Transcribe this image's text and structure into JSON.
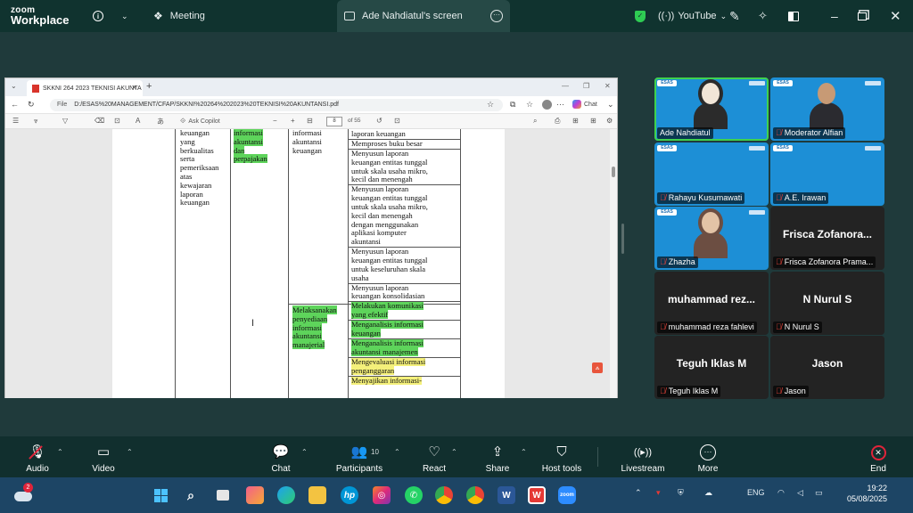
{
  "topbar": {
    "logo_line1": "zoom",
    "logo_line2": "Workplace",
    "info_icon": "i",
    "meeting_tab": "Meeting",
    "screen_tab": "Ade Nahdiatul's screen",
    "youtube_label": "YouTube"
  },
  "browser": {
    "tab_title": "SKKNI 264 2023 TEKNISI AKUNTA",
    "url_prefix": "File",
    "url": "D:/ESAS%20MANAGEMENT/CFAP/SKKNI%20264%202023%20TEKNISI%20AKUNTANSI.pdf",
    "copilot_label": "Chat",
    "ask_copilot": "Ask Copilot",
    "page_current": "8",
    "page_total": "of 55"
  },
  "pdf": {
    "col1_lines": [
      "keuangan",
      "yang",
      "berkualitas",
      "serta",
      "pemeriksaan",
      "atas",
      "kewajaran",
      "laporan",
      "keuangan"
    ],
    "col2_lines": [
      "informasi",
      "akuntansi",
      "dan",
      "perpajakan"
    ],
    "col3a_lines": [
      "informasi",
      "akuntansi",
      "keuangan"
    ],
    "col3b_lines": [
      "Melaksanakan",
      "penyediaan",
      "informasi",
      "akuntansi",
      "manajerial"
    ],
    "col4_rows": [
      {
        "lines": [
          "laporan keuangan"
        ],
        "hl": "none"
      },
      {
        "lines": [
          "Memproses buku besar"
        ],
        "hl": "none"
      },
      {
        "lines": [
          "Menyusun laporan",
          "keuangan entitas tunggal",
          "untuk skala usaha mikro,",
          "kecil dan menengah"
        ],
        "hl": "none"
      },
      {
        "lines": [
          "Menyusun laporan",
          "keuangan entitas tunggal",
          "untuk skala usaha mikro,",
          "kecil dan menengah",
          "dengan menggunakan",
          "aplikasi komputer",
          "akuntansi"
        ],
        "hl": "none"
      },
      {
        "lines": [
          "Menyusun laporan",
          "keuangan entitas tunggal",
          "untuk keseluruhan skala",
          "usaha"
        ],
        "hl": "none"
      },
      {
        "lines": [
          "Menyusun laporan",
          "keuangan konsolidasian"
        ],
        "hl": "none"
      },
      {
        "lines": [
          "Melakukan komunikasi",
          "yang efektif"
        ],
        "hl": "green"
      },
      {
        "lines": [
          "Menganalisis informasi",
          "keuangan"
        ],
        "hl": "green"
      },
      {
        "lines": [
          "Menganalisis informasi",
          "akuntansi manajemen"
        ],
        "hl": "green"
      },
      {
        "lines": [
          "Mengevaluasi informasi",
          "penganggaran"
        ],
        "hl": "yellow"
      },
      {
        "lines": [
          "Menyajikan informasi-"
        ],
        "hl": "yellow"
      }
    ]
  },
  "gallery": {
    "brand": "ESAS",
    "tiles": [
      {
        "name": "Ade Nahdiatul"
      },
      {
        "name": "Moderator Alfian"
      },
      {
        "name": "Rahayu Kusumawati"
      },
      {
        "name": "A.E. Irawan"
      },
      {
        "name": "Zhazha"
      },
      {
        "big": "Frisca Zofanora...",
        "name": "Frisca Zofanora Prama..."
      },
      {
        "big": "muhammad rez...",
        "name": "muhammad reza fahlevi"
      },
      {
        "big": "N Nurul S",
        "name": "N Nurul S"
      },
      {
        "big": "Teguh Iklas M",
        "name": "Teguh Iklas M"
      },
      {
        "big": "Jason",
        "name": "Jason"
      }
    ]
  },
  "controls": {
    "audio": "Audio",
    "video": "Video",
    "chat": "Chat",
    "participants": "Participants",
    "participants_count": "10",
    "react": "React",
    "share": "Share",
    "host_tools": "Host tools",
    "livestream": "Livestream",
    "more": "More",
    "end": "End"
  },
  "taskbar": {
    "notification_count": "2",
    "lang": "ENG",
    "time": "19:22",
    "date": "05/08/2025"
  },
  "colors": {
    "zoom_bg": "#10332f",
    "active_speaker": "#3fd14e",
    "highlight_green": "#5ed45b",
    "highlight_yellow": "#f4f07a",
    "end_red": "#e0243a"
  }
}
